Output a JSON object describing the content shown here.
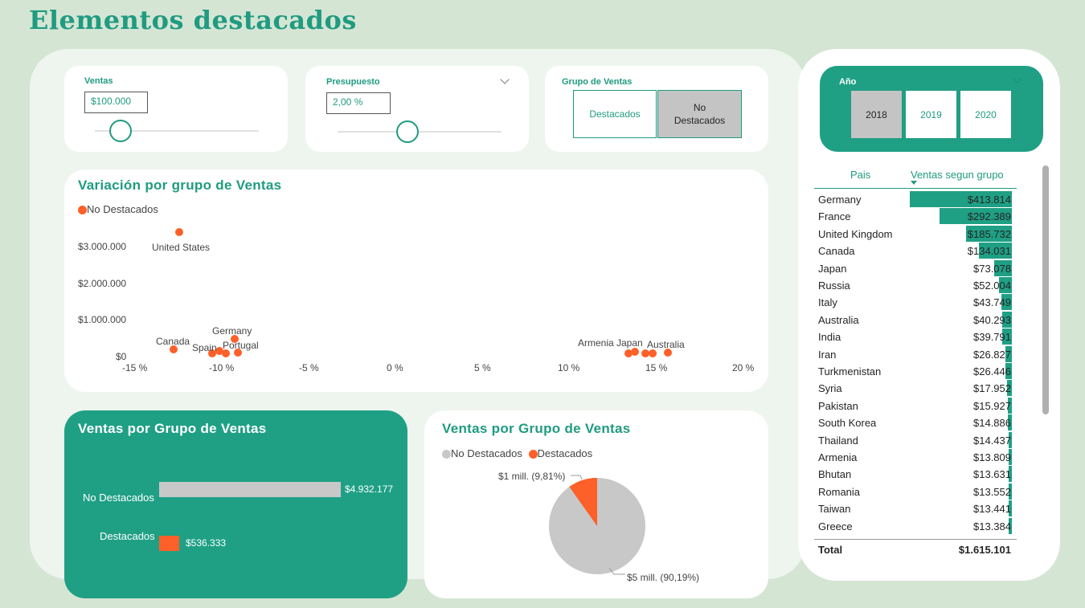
{
  "page": {
    "title": "Elementos destacados"
  },
  "slicers": {
    "ventas": {
      "title": "Ventas",
      "value": "$100.000"
    },
    "presupuesto": {
      "title": "Presupuesto",
      "value": "2,00 %"
    },
    "grupo": {
      "title": "Grupo de Ventas",
      "options": [
        "Destacados",
        "No Destacados"
      ],
      "selected": "No Destacados"
    },
    "anio": {
      "title": "Año",
      "options": [
        "2018",
        "2019",
        "2020"
      ],
      "selected": "2018"
    }
  },
  "scatter": {
    "title": "Variación por grupo de Ventas",
    "legend": "No Destacados",
    "yticks": [
      "$3.000.000",
      "$2.000.000",
      "$1.000.000",
      "$0"
    ],
    "xticks": [
      "-15 %",
      "-10 %",
      "-5 %",
      "0 %",
      "5 %",
      "10 %",
      "15 %",
      "20 %"
    ],
    "labels": {
      "us": "United States",
      "canada": "Canada",
      "germany": "Germany",
      "spain": "Spain",
      "portugal": "Portugal",
      "armenia": "Armenia",
      "japan": "Japan",
      "australia": "Australia"
    }
  },
  "chart_data": [
    {
      "type": "scatter",
      "title": "Variación por grupo de Ventas",
      "series": [
        {
          "name": "No Destacados",
          "points": [
            {
              "label": "United States",
              "x": -12.5,
              "y": 3300000
            },
            {
              "label": "Canada",
              "x": -12.8,
              "y": 134031
            },
            {
              "label": "Germany",
              "x": -9.3,
              "y": 413814
            },
            {
              "label": "Spain",
              "x": -10.2,
              "y": 90000
            },
            {
              "label": "Portugal",
              "x": -9.1,
              "y": 40000
            },
            {
              "label": "",
              "x": -10.6,
              "y": 20000
            },
            {
              "label": "",
              "x": -9.8,
              "y": 30000
            },
            {
              "label": "Armenia",
              "x": 13.4,
              "y": 13809
            },
            {
              "label": "Japan",
              "x": 13.8,
              "y": 73078
            },
            {
              "label": "",
              "x": 14.4,
              "y": 20000
            },
            {
              "label": "",
              "x": 14.8,
              "y": 20000
            },
            {
              "label": "Australia",
              "x": 15.7,
              "y": 40293
            }
          ]
        }
      ],
      "xlim": [
        -15,
        20
      ],
      "ylim": [
        0,
        3500000
      ]
    },
    {
      "type": "bar",
      "title": "Ventas por Grupo de Ventas",
      "categories": [
        "No Destacados",
        "Destacados"
      ],
      "values": [
        4932177,
        536333
      ],
      "value_labels": [
        "$4.932.177",
        "$536.333"
      ],
      "colors": [
        "#c8c8c8",
        "#fd6029"
      ]
    },
    {
      "type": "pie",
      "title": "Ventas por Grupo de Ventas",
      "legend": [
        "No Destacados",
        "Destacados"
      ],
      "values": [
        90.19,
        9.81
      ],
      "value_labels": [
        "$5 mill. (90,19%)",
        "$1 mill. (9,81%)"
      ],
      "colors": [
        "#c8c8c8",
        "#fd6029"
      ]
    }
  ],
  "bar_card": {
    "title": "Ventas por Grupo de Ventas",
    "rows": [
      {
        "category": "No Destacados",
        "label": "$4.932.177"
      },
      {
        "category": "Destacados",
        "label": "$536.333"
      }
    ]
  },
  "pie_card": {
    "title": "Ventas por Grupo de Ventas",
    "legend": [
      "No Destacados",
      "Destacados"
    ],
    "labels": [
      "$1 mill. (9,81%)",
      "$5 mill. (90,19%)"
    ]
  },
  "table": {
    "headers": [
      "Pais",
      "Ventas segun grupo"
    ],
    "rows": [
      {
        "pais": "Germany",
        "ventas": "$413.814",
        "v": 413814
      },
      {
        "pais": "France",
        "ventas": "$292.389",
        "v": 292389
      },
      {
        "pais": "United Kingdom",
        "ventas": "$185.732",
        "v": 185732
      },
      {
        "pais": "Canada",
        "ventas": "$134.031",
        "v": 134031
      },
      {
        "pais": "Japan",
        "ventas": "$73.078",
        "v": 73078
      },
      {
        "pais": "Russia",
        "ventas": "$52.004",
        "v": 52004
      },
      {
        "pais": "Italy",
        "ventas": "$43.749",
        "v": 43749
      },
      {
        "pais": "Australia",
        "ventas": "$40.293",
        "v": 40293
      },
      {
        "pais": "India",
        "ventas": "$39.791",
        "v": 39791
      },
      {
        "pais": "Iran",
        "ventas": "$26.827",
        "v": 26827
      },
      {
        "pais": "Turkmenistan",
        "ventas": "$26.446",
        "v": 26446
      },
      {
        "pais": "Syria",
        "ventas": "$17.952",
        "v": 17952
      },
      {
        "pais": "Pakistan",
        "ventas": "$15.927",
        "v": 15927
      },
      {
        "pais": "South Korea",
        "ventas": "$14.886",
        "v": 14886
      },
      {
        "pais": "Thailand",
        "ventas": "$14.437",
        "v": 14437
      },
      {
        "pais": "Armenia",
        "ventas": "$13.809",
        "v": 13809
      },
      {
        "pais": "Bhutan",
        "ventas": "$13.631",
        "v": 13631
      },
      {
        "pais": "Romania",
        "ventas": "$13.552",
        "v": 13552
      },
      {
        "pais": "Taiwan",
        "ventas": "$13.441",
        "v": 13441
      },
      {
        "pais": "Greece",
        "ventas": "$13.384",
        "v": 13384
      }
    ],
    "total_label": "Total",
    "total_value": "$1.615.101"
  },
  "colors": {
    "accent": "#1fa085",
    "orange": "#fd6029",
    "grey": "#c8c8c8",
    "background": "#d5e5d4"
  }
}
